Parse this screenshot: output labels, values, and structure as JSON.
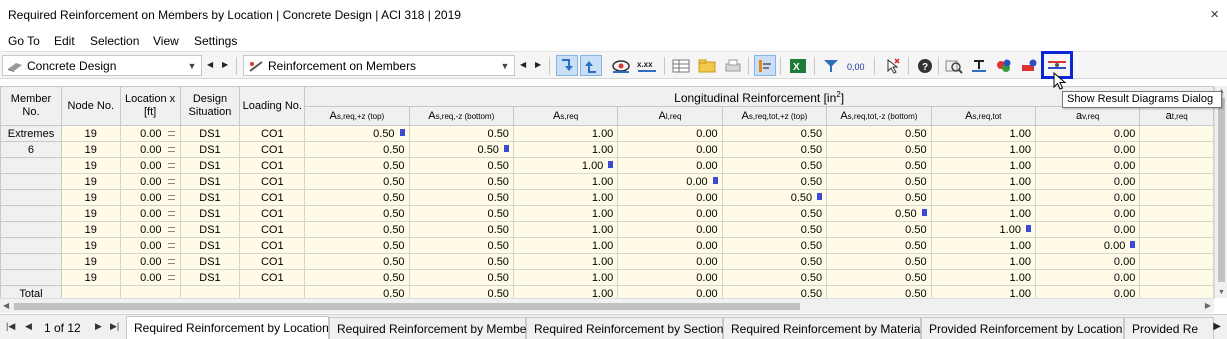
{
  "window": {
    "title": "Required Reinforcement on Members by Location | Concrete Design | ACI 318 | 2019",
    "close_glyph": "×"
  },
  "menu": [
    "Go To",
    "Edit",
    "Selection",
    "View",
    "Settings"
  ],
  "toolbar": {
    "module_combo": {
      "label": "Concrete Design",
      "icon": "concrete-design-icon"
    },
    "result_combo": {
      "label": "Reinforcement on Members",
      "icon": "member-reinforcement-icon"
    },
    "tooltip": "Show Result Diagrams Dialog",
    "accent": "#0b26d9",
    "selected_bg": "#c9dff5",
    "buttons": [
      "select-previous-icon",
      "select-next-icon",
      "view-icon",
      "values-icon",
      "table-icon",
      "folder-icon",
      "print-icon",
      "settings-icon",
      "excel-icon",
      "filter-icon",
      "decimal-icon",
      "delete-cursor-icon",
      "help-icon",
      "search-icon",
      "sections-icon",
      "materials-icon",
      "members-icon",
      "result-diagrams-icon"
    ],
    "decimal_label": "0,00",
    "values_label": "x.xx"
  },
  "table": {
    "headers": {
      "member": "Member No.",
      "node": "Node No.",
      "location": "Location x [ft]",
      "design_situation": "Design Situation",
      "loading": "Loading No.",
      "longitudinal": "Longitudinal Reinforcement [in",
      "longitudinal_sup": "2",
      "longitudinal_close": "]"
    },
    "sub_headers": [
      {
        "main": "A",
        "sub": "s,req,+z (top)"
      },
      {
        "main": "A",
        "sub": "s,req,-z (bottom)"
      },
      {
        "main": "A",
        "sub": "s,req"
      },
      {
        "main": "A",
        "sub": "l,req"
      },
      {
        "main": "A",
        "sub": "s,req,tot,+z (top)"
      },
      {
        "main": "A",
        "sub": "s,req,tot,-z (bottom)"
      },
      {
        "main": "A",
        "sub": "s,req,tot"
      },
      {
        "main": "a",
        "sub": "v,req"
      },
      {
        "main": "a",
        "sub": "t,req"
      }
    ],
    "extremes_label": "Extremes",
    "member_no": "6",
    "rows": [
      {
        "node": "19",
        "loc": "0.00",
        "ds": "DS1",
        "co": "CO1",
        "v": [
          "0.50",
          "0.50",
          "1.00",
          "0.00",
          "0.50",
          "0.50",
          "1.00",
          "0.00",
          ""
        ],
        "mark": 0
      },
      {
        "node": "19",
        "loc": "0.00",
        "ds": "DS1",
        "co": "CO1",
        "v": [
          "0.50",
          "0.50",
          "1.00",
          "0.00",
          "0.50",
          "0.50",
          "1.00",
          "0.00",
          ""
        ],
        "mark": 1
      },
      {
        "node": "19",
        "loc": "0.00",
        "ds": "DS1",
        "co": "CO1",
        "v": [
          "0.50",
          "0.50",
          "1.00",
          "0.00",
          "0.50",
          "0.50",
          "1.00",
          "0.00",
          ""
        ],
        "mark": 2
      },
      {
        "node": "19",
        "loc": "0.00",
        "ds": "DS1",
        "co": "CO1",
        "v": [
          "0.50",
          "0.50",
          "1.00",
          "0.00",
          "0.50",
          "0.50",
          "1.00",
          "0.00",
          ""
        ],
        "mark": 3
      },
      {
        "node": "19",
        "loc": "0.00",
        "ds": "DS1",
        "co": "CO1",
        "v": [
          "0.50",
          "0.50",
          "1.00",
          "0.00",
          "0.50",
          "0.50",
          "1.00",
          "0.00",
          ""
        ],
        "mark": 4
      },
      {
        "node": "19",
        "loc": "0.00",
        "ds": "DS1",
        "co": "CO1",
        "v": [
          "0.50",
          "0.50",
          "1.00",
          "0.00",
          "0.50",
          "0.50",
          "1.00",
          "0.00",
          ""
        ],
        "mark": 5
      },
      {
        "node": "19",
        "loc": "0.00",
        "ds": "DS1",
        "co": "CO1",
        "v": [
          "0.50",
          "0.50",
          "1.00",
          "0.00",
          "0.50",
          "0.50",
          "1.00",
          "0.00",
          ""
        ],
        "mark": 6
      },
      {
        "node": "19",
        "loc": "0.00",
        "ds": "DS1",
        "co": "CO1",
        "v": [
          "0.50",
          "0.50",
          "1.00",
          "0.00",
          "0.50",
          "0.50",
          "1.00",
          "0.00",
          ""
        ],
        "mark": 7
      },
      {
        "node": "19",
        "loc": "0.00",
        "ds": "DS1",
        "co": "CO1",
        "v": [
          "0.50",
          "0.50",
          "1.00",
          "0.00",
          "0.50",
          "0.50",
          "1.00",
          "0.00",
          ""
        ],
        "mark": -1
      },
      {
        "node": "19",
        "loc": "0.00",
        "ds": "DS1",
        "co": "CO1",
        "v": [
          "0.50",
          "0.50",
          "1.00",
          "0.00",
          "0.50",
          "0.50",
          "1.00",
          "0.00",
          ""
        ],
        "mark": -1
      }
    ],
    "total_label": "Total",
    "totals": [
      "0.50",
      "0.50",
      "1.00",
      "0.00",
      "0.50",
      "0.50",
      "1.00",
      "0.00",
      ""
    ],
    "mark_color": "#3c4bd6"
  },
  "pager": {
    "text": "1 of 12"
  },
  "tabs": [
    {
      "label": "Required Reinforcement by Location",
      "active": true
    },
    {
      "label": "Required Reinforcement by Member",
      "active": false
    },
    {
      "label": "Required Reinforcement by Section",
      "active": false
    },
    {
      "label": "Required Reinforcement by Material",
      "active": false
    },
    {
      "label": "Provided Reinforcement by Location",
      "active": false
    },
    {
      "label": "Provided Re",
      "active": false
    }
  ]
}
